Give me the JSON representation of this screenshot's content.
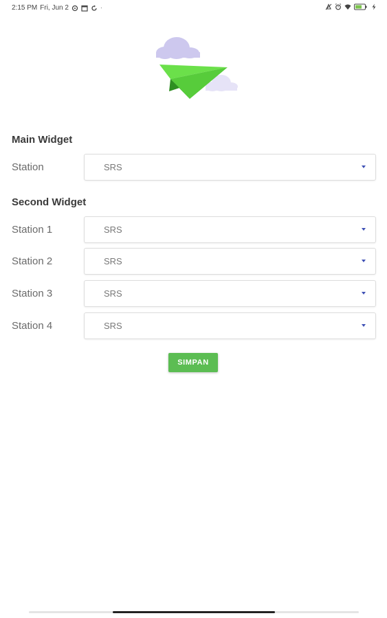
{
  "status_bar": {
    "time": "2:15 PM",
    "date": "Fri, Jun 2",
    "battery_color": "#7cc44e"
  },
  "main_widget": {
    "title": "Main Widget",
    "rows": [
      {
        "label": "Station",
        "value": "SRS"
      }
    ]
  },
  "second_widget": {
    "title": "Second Widget",
    "rows": [
      {
        "label": "Station 1",
        "value": "SRS"
      },
      {
        "label": "Station 2",
        "value": "SRS"
      },
      {
        "label": "Station 3",
        "value": "SRS"
      },
      {
        "label": "Station 4",
        "value": "SRS"
      }
    ]
  },
  "actions": {
    "save_label": "SIMPAN",
    "save_color": "#5cbd53"
  },
  "accent_color": "#3f51b5",
  "icons": [
    "cloud-icon",
    "paper-plane-icon",
    "chevron-down-icon"
  ]
}
